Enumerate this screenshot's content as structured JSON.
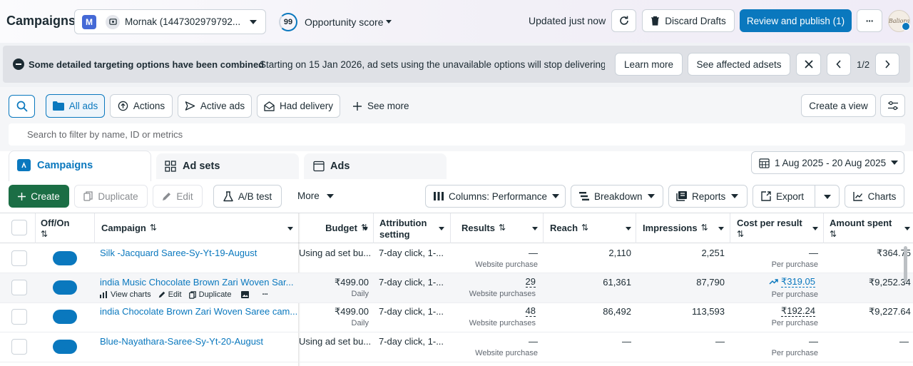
{
  "header": {
    "title": "Campaigns",
    "account_initial": "M",
    "account_name": "Mornak (1447302979792...",
    "opportunity_score": "99",
    "opportunity_label": "Opportunity score",
    "updated": "Updated just now",
    "discard": "Discard Drafts",
    "review": "Review and publish (1)",
    "more": "···",
    "avatar_text": "Baliora"
  },
  "banner": {
    "title": "Some detailed targeting options have been combined",
    "message": "Starting on 15 Jan 2026, ad sets using the unavailable options will stop delivering. ...",
    "learn_more": "Learn more",
    "see_affected": "See affected adsets",
    "pager": "1/2"
  },
  "filters": {
    "all_ads": "All ads",
    "actions": "Actions",
    "active_ads": "Active ads",
    "had_delivery": "Had delivery",
    "see_more": "See more",
    "create_view": "Create a view",
    "search_placeholder": "Search to filter by name, ID or metrics"
  },
  "tabs": {
    "campaigns": "Campaigns",
    "adsets": "Ad sets",
    "ads": "Ads",
    "date_range": "1 Aug 2025 - 20 Aug 2025"
  },
  "toolbar": {
    "create": "Create",
    "duplicate": "Duplicate",
    "edit": "Edit",
    "ab_test": "A/B test",
    "more": "More",
    "columns": "Columns: Performance",
    "breakdown": "Breakdown",
    "reports": "Reports",
    "export": "Export",
    "charts": "Charts"
  },
  "table": {
    "columns": {
      "offon": "Off/On",
      "sort": "⇅",
      "campaign": "Campaign",
      "budget": "Budget",
      "attribution_1": "Attribution",
      "attribution_2": "setting",
      "results": "Results",
      "reach": "Reach",
      "impressions": "Impressions",
      "cost": "Cost per result",
      "amount": "Amount spent"
    },
    "row_actions": {
      "view_charts": "View charts",
      "edit": "Edit",
      "duplicate": "Duplicate",
      "more": "···"
    },
    "rows": [
      {
        "name": "Silk -Jacquard Saree-Sy-Yt-19-August",
        "budget": "Using ad set bu...",
        "budget_sub": "",
        "attribution": "7-day click, 1-...",
        "results": "—",
        "results_sub": "Website purchase",
        "reach": "2,110",
        "impressions": "2,251",
        "cost": "—",
        "cost_sub": "Per purchase",
        "amount": "₹364.75"
      },
      {
        "name": "india Music Chocolate Brown Zari Woven Sar...",
        "budget": "₹499.00",
        "budget_sub": "Daily",
        "attribution": "7-day click, 1-...",
        "results": "29",
        "results_sub": "Website purchases",
        "reach": "61,361",
        "impressions": "87,790",
        "cost": "₹319.05",
        "cost_sub": "Per purchase",
        "amount": "₹9,252.34"
      },
      {
        "name": "india Chocolate Brown Zari Woven Saree cam...",
        "budget": "₹499.00",
        "budget_sub": "Daily",
        "attribution": "7-day click, 1-...",
        "results": "48",
        "results_sub": "Website purchases",
        "reach": "86,492",
        "impressions": "113,593",
        "cost": "₹192.24",
        "cost_sub": "Per purchase",
        "amount": "₹9,227.64"
      },
      {
        "name": "Blue-Nayathara-Saree-Sy-Yt-20-August",
        "budget": "Using ad set bu...",
        "budget_sub": "",
        "attribution": "7-day click, 1-...",
        "results": "—",
        "results_sub": "Website purchase",
        "reach": "—",
        "impressions": "—",
        "cost": "—",
        "cost_sub": "Per purchase",
        "amount": "—"
      }
    ]
  },
  "colors": {
    "brand_blue": "#0a78be",
    "create_green": "#1b6e45",
    "banner_bg": "#dfe1e6"
  }
}
